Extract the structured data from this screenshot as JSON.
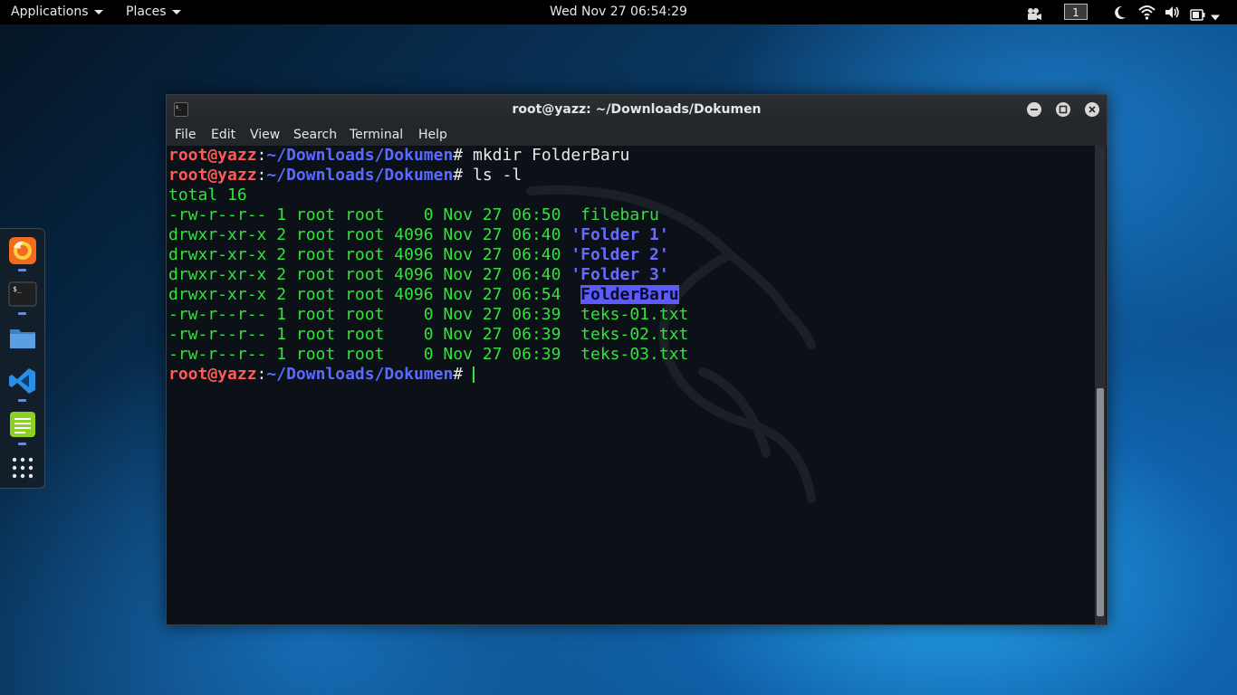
{
  "topbar": {
    "applications": "Applications",
    "places": "Places",
    "clock": "Wed Nov 27  06:54:29",
    "workspace": "1",
    "icons": [
      "camera-icon",
      "moon-icon",
      "wifi-icon",
      "volume-icon",
      "battery-icon",
      "power-icon"
    ]
  },
  "dock": {
    "apps": [
      "firefox-icon",
      "terminal-icon",
      "files-icon",
      "vscode-icon",
      "text-editor-icon",
      "app-grid-icon"
    ]
  },
  "window": {
    "title": "root@yazz: ~/Downloads/Dokumen",
    "menu": [
      "File",
      "Edit",
      "View",
      "Search",
      "Terminal",
      "Help"
    ]
  },
  "terminal": {
    "user": "root@yazz",
    "colon": ":",
    "path": "~/Downloads/Dokumen",
    "hash": "#",
    "cmd1": " mkdir FolderBaru",
    "cmd2": " ls -l",
    "total": "total 16",
    "rows": [
      {
        "meta": "-rw-r--r-- 1 root root    0 Nov 27 06:50  ",
        "name": "filebaru",
        "kind": "file"
      },
      {
        "meta": "drwxr-xr-x 2 root root 4096 Nov 27 06:40 ",
        "name": "'Folder 1'",
        "kind": "dir"
      },
      {
        "meta": "drwxr-xr-x 2 root root 4096 Nov 27 06:40 ",
        "name": "'Folder 2'",
        "kind": "dir"
      },
      {
        "meta": "drwxr-xr-x 2 root root 4096 Nov 27 06:40 ",
        "name": "'Folder 3'",
        "kind": "dir"
      },
      {
        "meta": "drwxr-xr-x 2 root root 4096 Nov 27 06:54  ",
        "name": "FolderBaru",
        "kind": "highlight"
      },
      {
        "meta": "-rw-r--r-- 1 root root    0 Nov 27 06:39  ",
        "name": "teks-01.txt",
        "kind": "file"
      },
      {
        "meta": "-rw-r--r-- 1 root root    0 Nov 27 06:39  ",
        "name": "teks-02.txt",
        "kind": "file"
      },
      {
        "meta": "-rw-r--r-- 1 root root    0 Nov 27 06:39  ",
        "name": "teks-03.txt",
        "kind": "file"
      }
    ]
  },
  "colors": {
    "user": "#ff5a5a",
    "path": "#5a6aff",
    "output": "#33e23a",
    "selection": "#5a5aff"
  }
}
